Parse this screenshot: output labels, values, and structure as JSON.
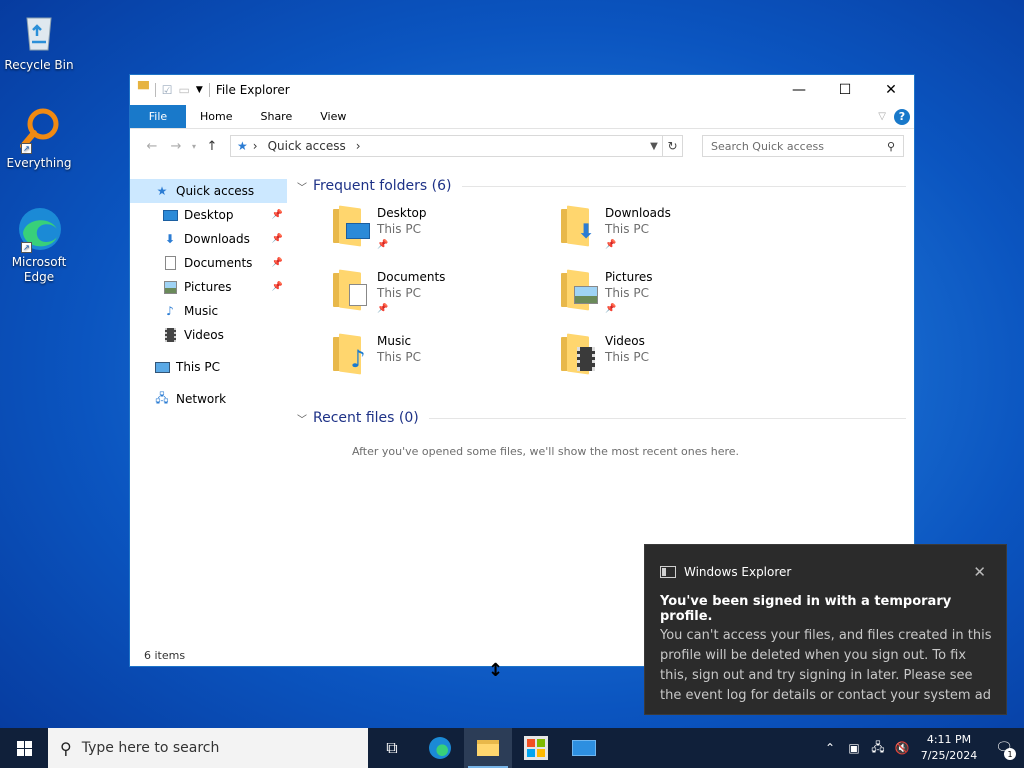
{
  "desktop": {
    "icons": [
      {
        "label": "Recycle Bin",
        "icon": "recycle-bin-icon"
      },
      {
        "label": "Everything",
        "icon": "everything-search-icon"
      },
      {
        "label": "Microsoft Edge",
        "icon": "edge-icon"
      }
    ]
  },
  "window": {
    "title": "File Explorer",
    "ribbon_tabs": [
      "File",
      "Home",
      "Share",
      "View"
    ],
    "help_label": "?",
    "address_segment": "Quick access",
    "search_placeholder": "Search Quick access",
    "nav_items": [
      {
        "label": "Quick access",
        "icon": "star-icon",
        "selected": true
      },
      {
        "label": "Desktop",
        "icon": "desktop-icon",
        "pinned": true
      },
      {
        "label": "Downloads",
        "icon": "download-icon",
        "pinned": true
      },
      {
        "label": "Documents",
        "icon": "document-icon",
        "pinned": true
      },
      {
        "label": "Pictures",
        "icon": "picture-icon",
        "pinned": true
      },
      {
        "label": "Music",
        "icon": "music-icon"
      },
      {
        "label": "Videos",
        "icon": "video-icon"
      },
      {
        "label": "This PC",
        "icon": "computer-icon"
      },
      {
        "label": "Network",
        "icon": "network-icon"
      }
    ],
    "frequent_heading": "Frequent folders (6)",
    "folders": [
      {
        "name": "Desktop",
        "location": "This PC",
        "pinned": true
      },
      {
        "name": "Downloads",
        "location": "This PC",
        "pinned": true
      },
      {
        "name": "Documents",
        "location": "This PC",
        "pinned": true
      },
      {
        "name": "Pictures",
        "location": "This PC",
        "pinned": true
      },
      {
        "name": "Music",
        "location": "This PC"
      },
      {
        "name": "Videos",
        "location": "This PC"
      }
    ],
    "recent_heading": "Recent files (0)",
    "recent_empty": "After you've opened some files, we'll show the most recent ones here.",
    "status": "6 items"
  },
  "toast": {
    "app": "Windows Explorer",
    "title": "You've been signed in with a temporary profile.",
    "body": "You can't access your files, and files created in this profile will be deleted when you sign out. To fix this, sign out and try signing in later.  Please see the event log for details or contact your system ad"
  },
  "taskbar": {
    "search_placeholder": "Type here to search",
    "time": "4:11 PM",
    "date": "7/25/2024",
    "notification_count": "1"
  }
}
